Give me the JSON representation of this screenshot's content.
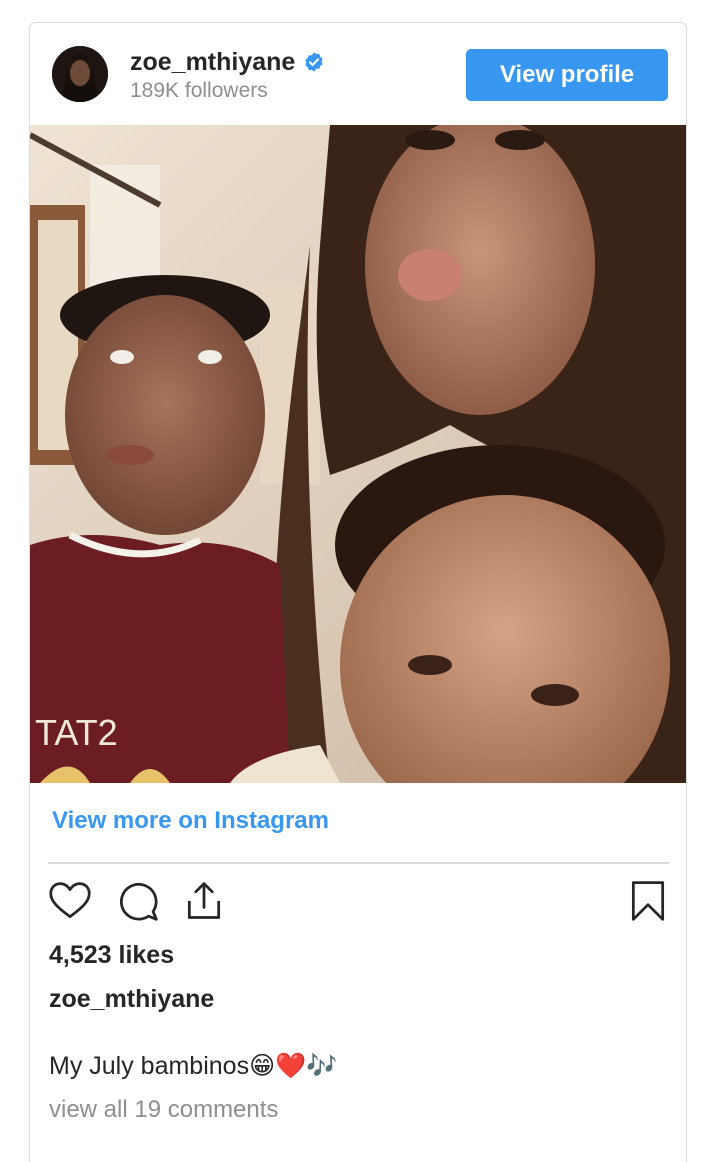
{
  "header": {
    "username": "zoe_mthiyane",
    "verified": true,
    "followers": "189K followers",
    "view_profile_label": "View profile",
    "accent_color": "#3897f0"
  },
  "post": {
    "view_more_label": "View more on Instagram",
    "likes": "4,523 likes",
    "caption_user": "zoe_mthiyane",
    "caption_text": "My July bambinos😁❤️🎶",
    "comments_link": "view all 19 comments"
  },
  "icons": {
    "actions": [
      "heart-icon",
      "comment-icon",
      "share-icon",
      "bookmark-icon"
    ],
    "verified": "verified-badge-icon"
  }
}
